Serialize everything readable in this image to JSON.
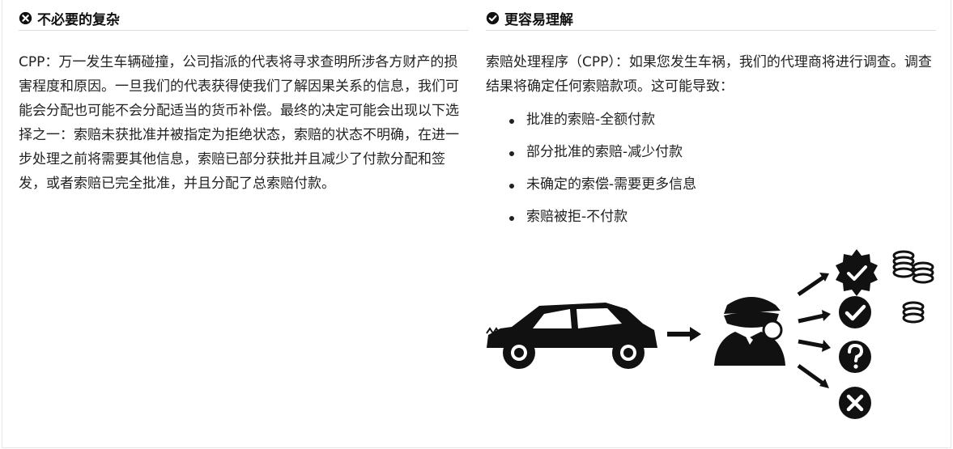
{
  "left": {
    "icon": "x-circle-icon",
    "heading": "不必要的复杂",
    "paragraph": "CPP：万一发生车辆碰撞，公司指派的代表将寻求查明所涉各方财产的损害程度和原因。一旦我们的代表获得使我们了解因果关系的信息，我们可能会分配也可能不会分配适当的货币补偿。最终的决定可能会出现以下选择之一：索赔未获批准并被指定为拒绝状态，索赔的状态不明确，在进一步处理之前将需要其他信息，索赔已部分获批并且减少了付款分配和签发，或者索赔已完全批准，并且分配了总索赔付款。"
  },
  "right": {
    "icon": "check-circle-icon",
    "heading": "更容易理解",
    "paragraph": "索赔处理程序（CPP）：如果您发生车祸，我们的代理商将进行调查。调查结果将确定任何索赔款项。这可能导致：",
    "outcomes": [
      "批准的索赔-全额付款",
      "部分批准的索赔-减少付款",
      "未确定的索偿-需要更多信息",
      "索赔被拒-不付款"
    ]
  },
  "illustration": {
    "icons": [
      "car-icon",
      "arrow-right-icon",
      "detective-icon",
      "verified-badge-icon",
      "check-circle-icon",
      "question-circle-icon",
      "x-circle-icon",
      "coins-large-icon",
      "coins-small-icon"
    ]
  }
}
